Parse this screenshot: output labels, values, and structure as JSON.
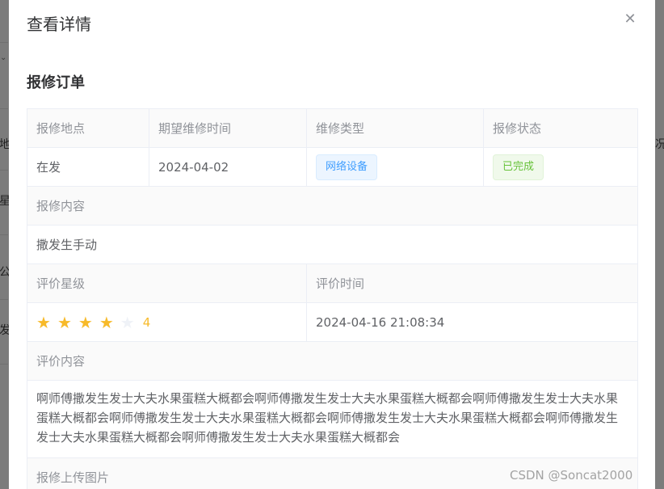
{
  "dialog": {
    "title": "查看详情",
    "close_icon": "close-icon"
  },
  "section": {
    "title": "报修订单"
  },
  "order": {
    "headers": [
      "报修地点",
      "期望维修时间",
      "维修类型",
      "报修状态"
    ],
    "location": "在发",
    "expected_time": "2024-04-02",
    "repair_type": "网络设备",
    "status": "已完成"
  },
  "content": {
    "label": "报修内容",
    "value": "撒发生手动"
  },
  "rating": {
    "label": "评价星级",
    "time_label": "评价时间",
    "stars": 4,
    "max_stars": 5,
    "score_text": "4",
    "time": "2024-04-16 21:08:34"
  },
  "review": {
    "label": "评价内容",
    "text": "啊师傅撒发生发士大夫水果蛋糕大概都会啊师傅撒发生发士大夫水果蛋糕大概都会啊师傅撒发生发士大夫水果蛋糕大概都会啊师傅撒发生发士大夫水果蛋糕大概都会啊师傅撒发生发士大夫水果蛋糕大概都会啊师傅撒发生发士大夫水果蛋糕大概都会啊师傅撒发生发士大夫水果蛋糕大概都会"
  },
  "images": {
    "label": "报修上传图片"
  },
  "watermark": "CSDN @Soncat2000",
  "background": {
    "left_glyphs": [
      "地",
      "星",
      "公",
      "发"
    ],
    "right_glyph": "况"
  },
  "colors": {
    "tag_blue": "#409eff",
    "tag_green": "#67c23a",
    "star_active": "#f7ba2a"
  }
}
